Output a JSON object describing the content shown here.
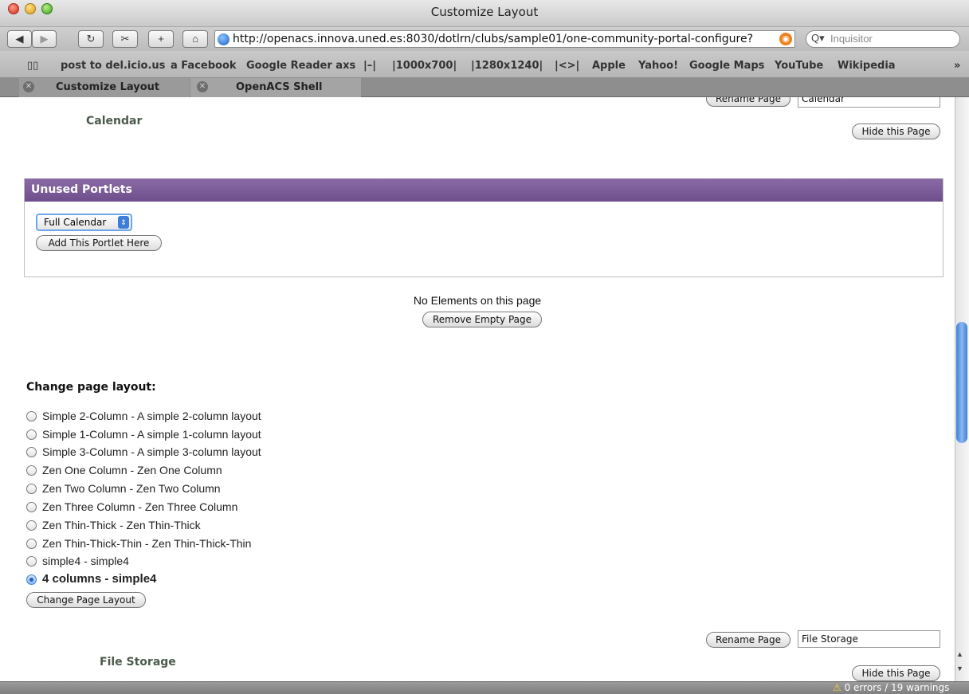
{
  "window": {
    "title": "Customize Layout"
  },
  "toolbar": {
    "back_icon": "back-arrow-icon",
    "forward_icon": "forward-arrow-icon",
    "reload_icon": "reload-icon",
    "snapshot_icon": "snapshot-icon",
    "add_bookmark_label": "+",
    "home_icon": "home-icon",
    "url": "http://openacs.innova.uned.es:8030/dotlrn/clubs/sample01/one-community-portal-configure?",
    "search_placeholder": "Inquisitor"
  },
  "bookmarks": [
    "post to del.icio.us",
    "a Facebook",
    "Google Reader axs",
    "|–|",
    "|1000x700|",
    "|1280x1240|",
    "|<>|",
    "Apple",
    "Yahoo!",
    "Google Maps",
    "YouTube",
    "Wikipedia"
  ],
  "bookmarks_overflow": "»",
  "tabs": [
    {
      "label": "Customize Layout"
    },
    {
      "label": "OpenACS Shell"
    }
  ],
  "page": {
    "calendar": {
      "rename_label": "Rename Page",
      "name_value": "Calendar",
      "title": "Calendar",
      "hide_label": "Hide this Page"
    },
    "unused": {
      "title": "Unused Portlets",
      "selected_option": "Full Calendar",
      "add_label": "Add This Portlet Here"
    },
    "no_elements": "No Elements on this page",
    "remove_empty_label": "Remove Empty Page",
    "layout": {
      "heading": "Change page layout:",
      "options": [
        "Simple 2-Column - A simple 2-column layout",
        "Simple 1-Column - A simple 1-column layout",
        "Simple 3-Column - A simple 3-column layout",
        "Zen One Column - Zen One Column",
        "Zen Two Column - Zen Two Column",
        "Zen Three Column - Zen Three Column",
        "Zen Thin-Thick - Zen Thin-Thick",
        "Zen Thin-Thick-Thin - Zen Thin-Thick-Thin",
        "simple4 - simple4",
        "4 columns - simple4"
      ],
      "selected": "4 columns - simple4",
      "change_label": "Change Page Layout"
    },
    "file_storage": {
      "rename_label": "Rename Page",
      "name_value": "File Storage",
      "title": "File Storage",
      "hide_label": "Hide this Page"
    }
  },
  "status": {
    "text": "0 errors / 19 warnings"
  }
}
